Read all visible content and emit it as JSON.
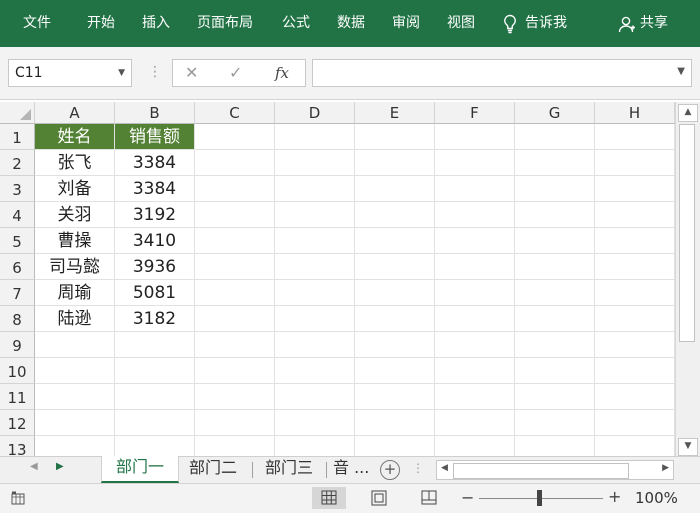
{
  "ribbon": {
    "tabs": [
      "文件",
      "开始",
      "插入",
      "页面布局",
      "公式",
      "数据",
      "审阅",
      "视图"
    ],
    "tell_me": "告诉我",
    "share": "共享"
  },
  "formula_bar": {
    "name_box": "C11",
    "cancel_icon": "✕",
    "enter_icon": "✓",
    "fx_label": "fx",
    "formula": ""
  },
  "grid": {
    "columns": [
      "A",
      "B",
      "C",
      "D",
      "E",
      "F",
      "G",
      "H"
    ],
    "row_numbers": [
      "1",
      "2",
      "3",
      "4",
      "5",
      "6",
      "7",
      "8",
      "9",
      "10",
      "11",
      "12",
      "13"
    ],
    "header": [
      "姓名",
      "销售额"
    ],
    "rows": [
      [
        "张飞",
        "3384"
      ],
      [
        "刘备",
        "3384"
      ],
      [
        "关羽",
        "3192"
      ],
      [
        "曹操",
        "3410"
      ],
      [
        "司马懿",
        "3936"
      ],
      [
        "周瑜",
        "5081"
      ],
      [
        "陆逊",
        "3182"
      ]
    ],
    "header_fill_color": "#548235"
  },
  "sheets": {
    "tabs": [
      "部门一",
      "部门二",
      "部门三",
      "音 ..."
    ],
    "active_index": 0
  },
  "status": {
    "zoom": "100%",
    "zoom_minus": "−",
    "zoom_plus": "+"
  },
  "colors": {
    "ribbon": "#217346",
    "accent": "#217346"
  }
}
